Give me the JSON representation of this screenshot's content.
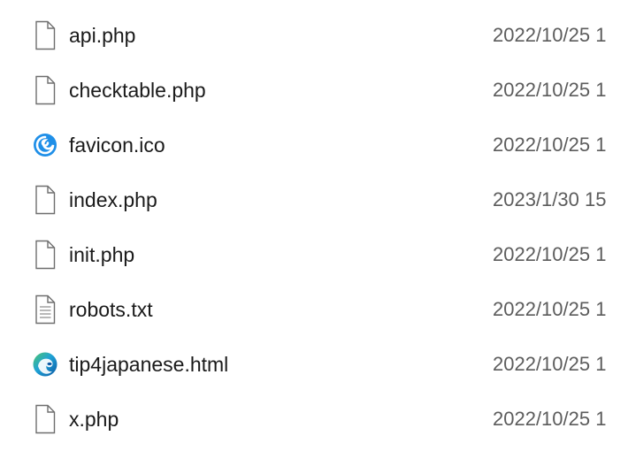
{
  "files": [
    {
      "name": "api.php",
      "modified": "2022/10/25 1",
      "icon": "blank-file-icon"
    },
    {
      "name": "checktable.php",
      "modified": "2022/10/25 1",
      "icon": "blank-file-icon"
    },
    {
      "name": "favicon.ico",
      "modified": "2022/10/25 1",
      "icon": "favicon-icon"
    },
    {
      "name": "index.php",
      "modified": "2023/1/30 15",
      "icon": "blank-file-icon"
    },
    {
      "name": "init.php",
      "modified": "2022/10/25 1",
      "icon": "blank-file-icon"
    },
    {
      "name": "robots.txt",
      "modified": "2022/10/25 1",
      "icon": "text-file-icon"
    },
    {
      "name": "tip4japanese.html",
      "modified": "2022/10/25 1",
      "icon": "edge-browser-icon"
    },
    {
      "name": "x.php",
      "modified": "2022/10/25 1",
      "icon": "blank-file-icon"
    }
  ],
  "colors": {
    "name_text": "#1a1a1a",
    "date_text": "#5c5c5c",
    "icon_outline": "#6e6e6e",
    "favicon_blue": "#1f8fe8",
    "edge_blue": "#0c59a4",
    "edge_green": "#4fc66b"
  }
}
